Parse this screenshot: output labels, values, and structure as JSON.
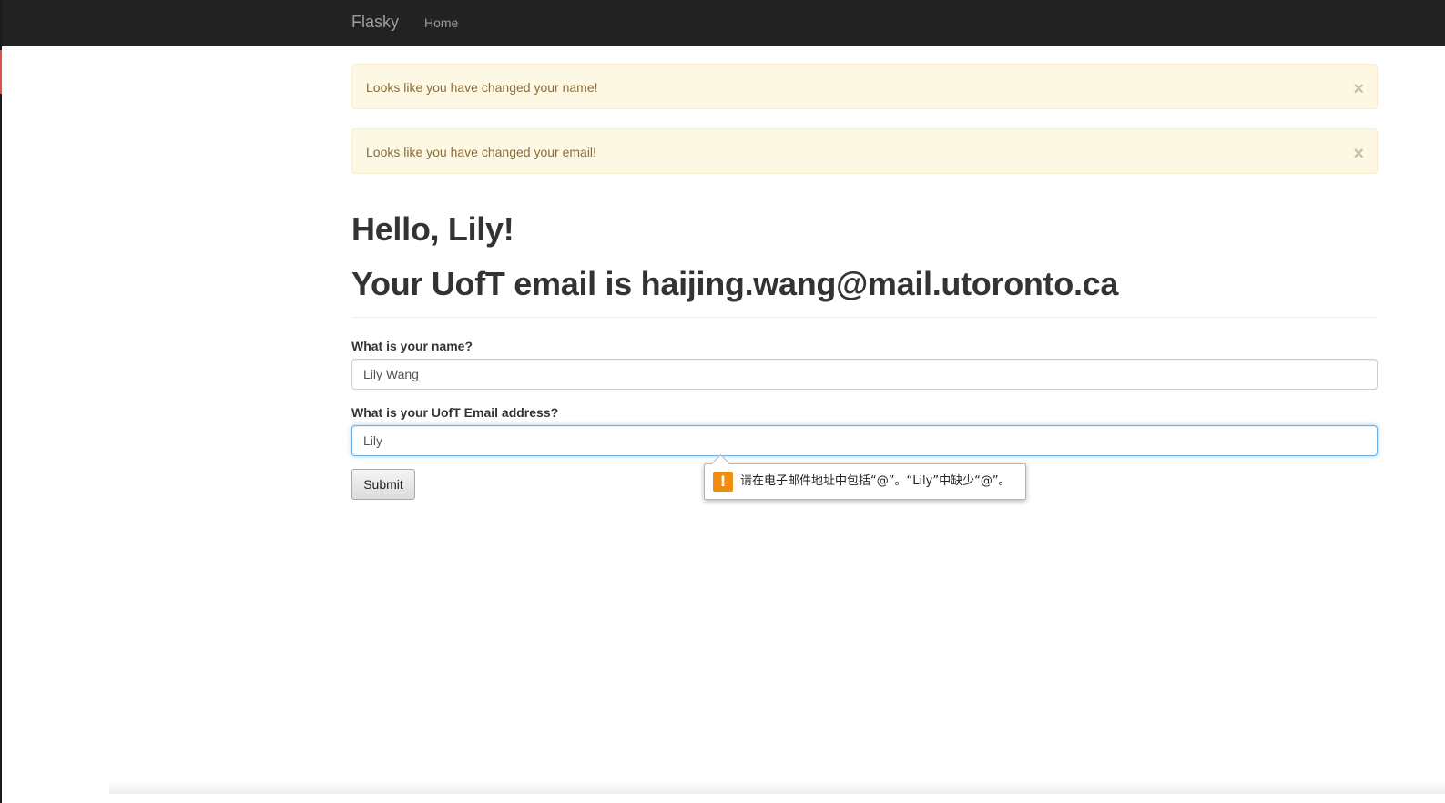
{
  "navbar": {
    "brand": "Flasky",
    "links": [
      {
        "label": "Home"
      }
    ]
  },
  "alerts": [
    {
      "message": "Looks like you have changed your name!",
      "close": "×"
    },
    {
      "message": "Looks like you have changed your email!",
      "close": "×"
    }
  ],
  "greeting": "Hello, Lily!",
  "email_heading": "Your UofT email is haijing.wang@mail.utoronto.ca",
  "form": {
    "name": {
      "label": "What is your name?",
      "value": "Lily Wang"
    },
    "email": {
      "label": "What is your UofT Email address?",
      "value": "Lily"
    },
    "submit_label": "Submit"
  },
  "validation_tooltip": {
    "icon": "warning-icon",
    "icon_glyph": "!",
    "message": "请在电子邮件地址中包括“@”。“Lily”中缺少“@”。"
  },
  "colors": {
    "navbar_bg": "#222222",
    "alert_bg": "#fcf8e3",
    "alert_text": "#8a6d3b",
    "focus_border": "#66afe9",
    "warning_icon": "#f28c0f"
  }
}
